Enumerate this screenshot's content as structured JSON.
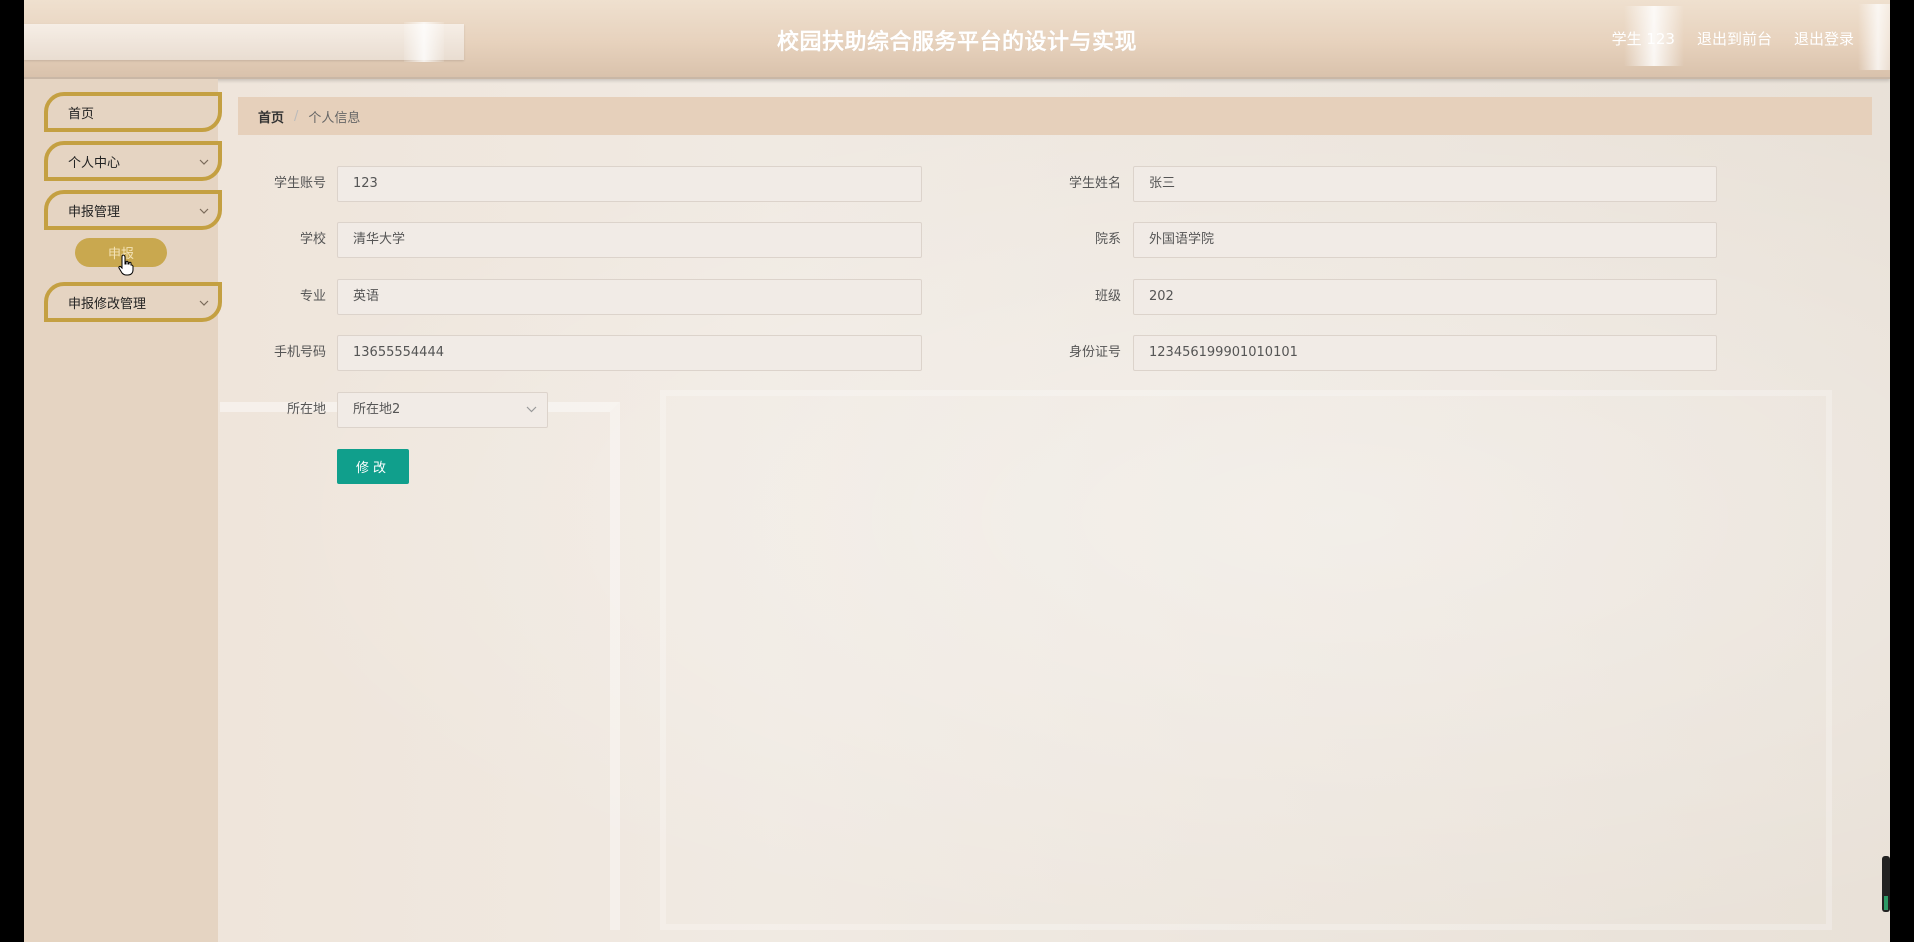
{
  "header": {
    "title": "校园扶助综合服务平台的设计与实现",
    "user_label": "学生 123",
    "front_link": "退出到前台",
    "logout_link": "退出登录"
  },
  "sidebar": {
    "items": [
      {
        "label": "首页",
        "has_children": false
      },
      {
        "label": "个人中心",
        "has_children": true
      },
      {
        "label": "申报管理",
        "has_children": true
      },
      {
        "label": "申报修改管理",
        "has_children": true
      }
    ],
    "submenu_label": "申报"
  },
  "breadcrumb": {
    "home": "首页",
    "separator": "/",
    "current": "个人信息"
  },
  "form": {
    "student_account": {
      "label": "学生账号",
      "value": "123"
    },
    "student_name": {
      "label": "学生姓名",
      "value": "张三"
    },
    "school": {
      "label": "学校",
      "value": "清华大学"
    },
    "department": {
      "label": "院系",
      "value": "外国语学院"
    },
    "major": {
      "label": "专业",
      "value": "英语"
    },
    "class": {
      "label": "班级",
      "value": "202"
    },
    "phone": {
      "label": "手机号码",
      "value": "13655554444"
    },
    "id_card": {
      "label": "身份证号",
      "value": "123456199901010101"
    },
    "location": {
      "label": "所在地",
      "value": "所在地2"
    },
    "submit_label": "修改"
  },
  "colors": {
    "accent_gold": "#c4a042",
    "submit_green": "#109f8c",
    "breadcrumb_bg": "#e6d0bb",
    "sidebar_bg": "#e5d4c2"
  },
  "icons": {
    "chevron": "chevron-down-icon",
    "cursor": "hand-pointer-icon"
  }
}
